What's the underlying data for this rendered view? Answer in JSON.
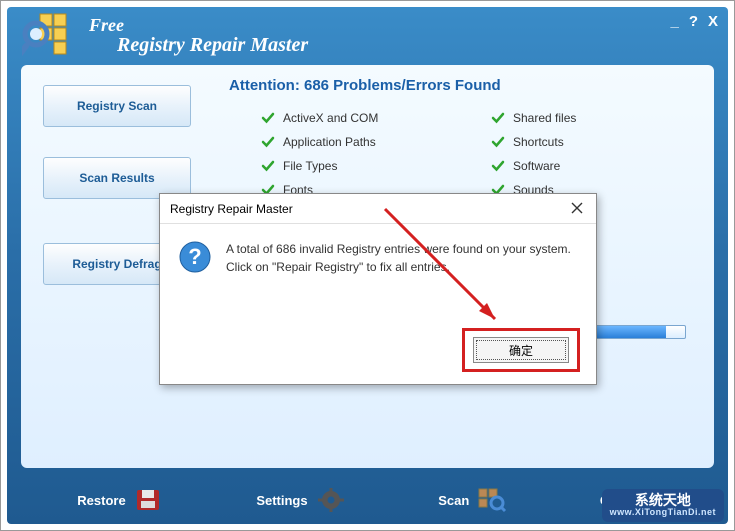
{
  "app": {
    "title_line1": "Free",
    "title_line2": "Registry Repair Master"
  },
  "win_controls": {
    "minimize": "_",
    "help": "?",
    "close": "X"
  },
  "sidebar": {
    "buttons": [
      {
        "label": "Registry Scan"
      },
      {
        "label": "Scan Results"
      },
      {
        "label": "Registry Defrag"
      }
    ]
  },
  "attention": "Attention: 686 Problems/Errors Found",
  "categories_col1": [
    "ActiveX and COM",
    "Application Paths",
    "File Types",
    "Fonts"
  ],
  "categories_col2": [
    "Shared files",
    "Shortcuts",
    "Software",
    "Sounds"
  ],
  "dialog": {
    "title": "Registry Repair Master",
    "line1": "A total of 686 invalid Registry entries were found on your system.",
    "line2": "Click on \"Repair Registry\" to fix all entries.",
    "ok": "确定"
  },
  "footer": {
    "items": [
      {
        "label": "Restore"
      },
      {
        "label": "Settings"
      },
      {
        "label": "Scan"
      },
      {
        "label": "Overview"
      }
    ]
  },
  "watermark": {
    "text": "系统天地",
    "url": "www.XiTongTianDi.net"
  }
}
